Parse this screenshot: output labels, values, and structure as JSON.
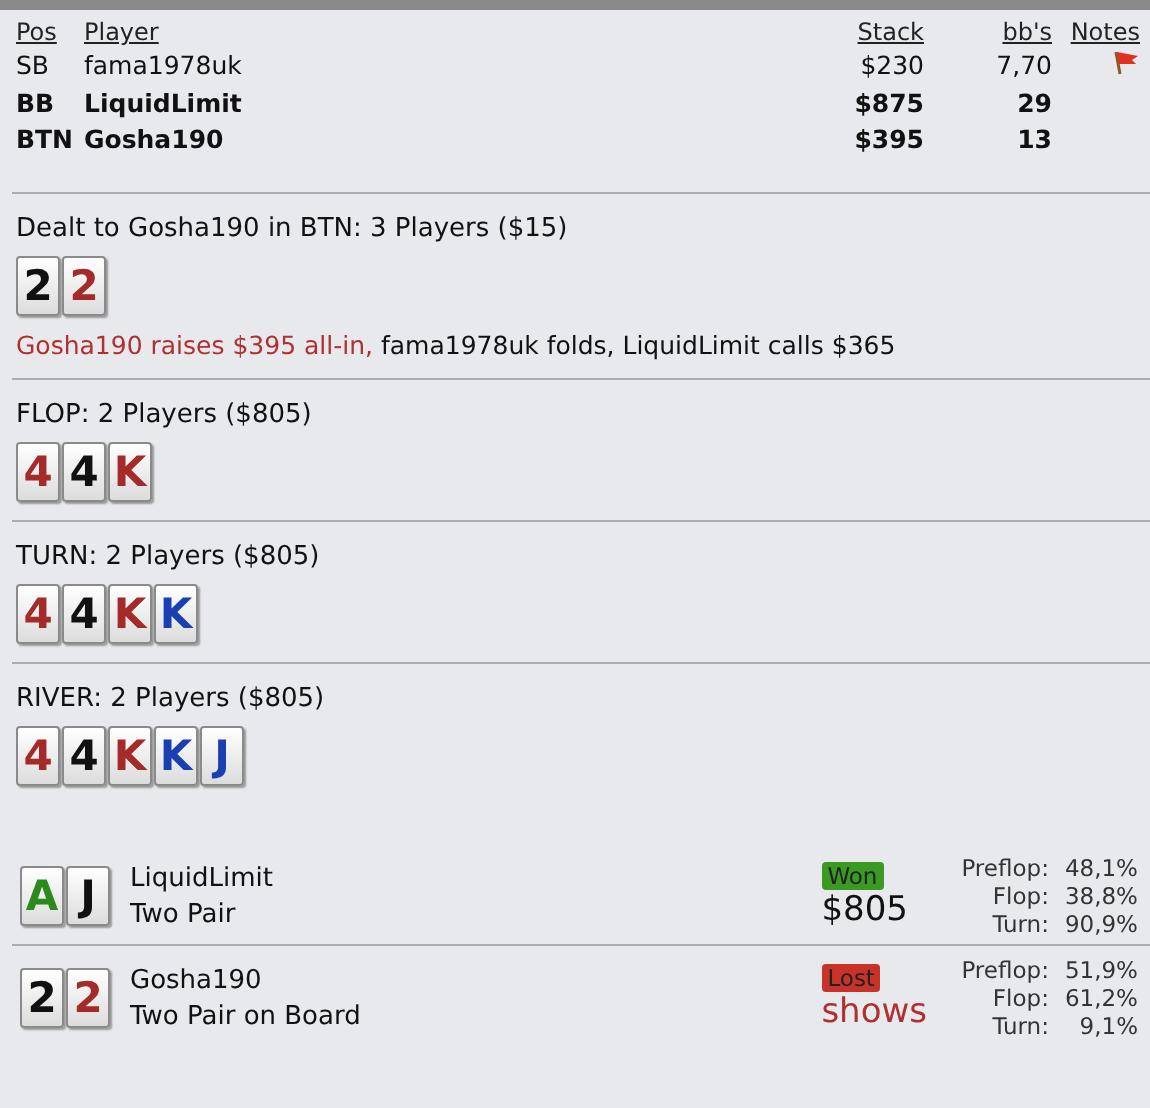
{
  "players_table": {
    "columns": [
      "Pos",
      "Player",
      "Stack",
      "bb's",
      "Notes"
    ],
    "rows": [
      {
        "pos": "SB",
        "player": "fama1978uk",
        "stack": "$230",
        "bbs": "7,70",
        "bold": false,
        "note_flag": true
      },
      {
        "pos": "BB",
        "player": "LiquidLimit",
        "stack": "$875",
        "bbs": "29",
        "bold": true,
        "note_flag": false
      },
      {
        "pos": "BTN",
        "player": "Gosha190",
        "stack": "$395",
        "bbs": "13",
        "bold": true,
        "note_flag": false
      }
    ]
  },
  "streets": [
    {
      "title": "Dealt to Gosha190 in BTN: 3 Players ($15)",
      "cards": [
        {
          "rank": "2",
          "color": "#111111"
        },
        {
          "rank": "2",
          "color": "#a52a2a"
        }
      ],
      "actions": [
        {
          "text": "Gosha190 raises $395 all-in,",
          "kind": "hero"
        },
        {
          "text": "fama1978uk folds, LiquidLimit calls $365",
          "kind": "other"
        }
      ]
    },
    {
      "title": "FLOP: 2 Players ($805)",
      "cards": [
        {
          "rank": "4",
          "color": "#a52a2a"
        },
        {
          "rank": "4",
          "color": "#111111"
        },
        {
          "rank": "K",
          "color": "#a52a2a"
        }
      ]
    },
    {
      "title": "TURN: 2 Players ($805)",
      "cards": [
        {
          "rank": "4",
          "color": "#a52a2a"
        },
        {
          "rank": "4",
          "color": "#111111"
        },
        {
          "rank": "K",
          "color": "#a52a2a"
        },
        {
          "rank": "K",
          "color": "#1a3fb0"
        }
      ]
    },
    {
      "title": "RIVER: 2 Players ($805)",
      "cards": [
        {
          "rank": "4",
          "color": "#a52a2a"
        },
        {
          "rank": "4",
          "color": "#111111"
        },
        {
          "rank": "K",
          "color": "#a52a2a"
        },
        {
          "rank": "K",
          "color": "#1a3fb0"
        },
        {
          "rank": "J",
          "color": "#1a3fb0"
        }
      ]
    }
  ],
  "results": [
    {
      "cards": [
        {
          "rank": "A",
          "color": "#2a8a1a"
        },
        {
          "rank": "J",
          "color": "#111111"
        }
      ],
      "player": "LiquidLimit",
      "hand": "Two Pair",
      "won": true,
      "badge": "Won",
      "amount": "$805",
      "equity": [
        {
          "label": "Preflop:",
          "value": "48,1%"
        },
        {
          "label": "Flop:",
          "value": "38,8%"
        },
        {
          "label": "Turn:",
          "value": "90,9%"
        }
      ]
    },
    {
      "cards": [
        {
          "rank": "2",
          "color": "#111111"
        },
        {
          "rank": "2",
          "color": "#a52a2a"
        }
      ],
      "player": "Gosha190",
      "hand": "Two Pair on Board",
      "won": false,
      "badge": "Lost",
      "amount": "shows",
      "equity": [
        {
          "label": "Preflop:",
          "value": "51,9%"
        },
        {
          "label": "Flop:",
          "value": "61,2%"
        },
        {
          "label": "Turn:",
          "value": "9,1%"
        }
      ]
    }
  ]
}
